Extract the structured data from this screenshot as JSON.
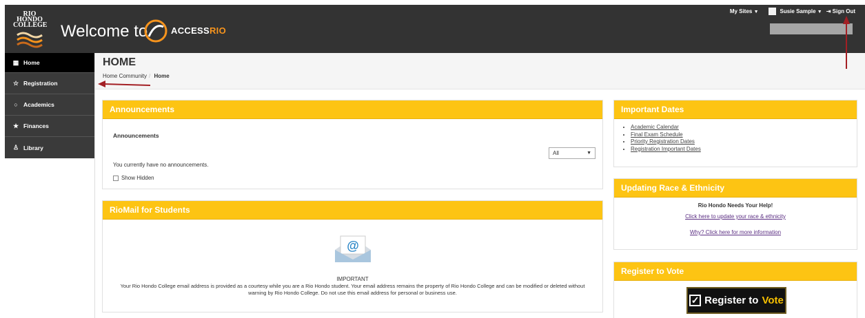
{
  "header": {
    "logo_text": "RIO HONDO COLLEGE",
    "welcome": "Welcome to",
    "brand_prefix": "ACCESS",
    "brand_suffix": "RIO",
    "my_sites": "My Sites",
    "user_name": "Susie Sample",
    "sign_out": "Sign Out",
    "search_icon": "search-bar",
    "accent_color": "#f7941d"
  },
  "sidebar": {
    "items": [
      {
        "label": "Home",
        "icon": "grid-icon",
        "active": true
      },
      {
        "label": "Registration",
        "icon": "star-outline-icon"
      },
      {
        "label": "Academics",
        "icon": "circle-icon"
      },
      {
        "label": "Finances",
        "icon": "star-half-icon"
      },
      {
        "label": "Library",
        "icon": "person-icon"
      }
    ]
  },
  "page": {
    "title": "HOME",
    "breadcrumb": [
      "Home Community",
      "Home"
    ]
  },
  "announcements": {
    "header": "Announcements",
    "subheader": "Announcements",
    "filter_value": "All",
    "empty_text": "You currently have no announcements.",
    "show_hidden_label": "Show Hidden"
  },
  "riomail": {
    "header": "RioMail for Students",
    "important": "IMPORTANT",
    "text": "Your Rio Hondo College email address is provided as a courtesy while you are a Rio Hondo student. Your email address remains the property of Rio Hondo College and can be modified or deleted without warning by Rio Hondo College. Do not use this email address for personal or business use."
  },
  "important_dates": {
    "header": "Important Dates",
    "links": [
      "Academic Calendar",
      "Final Exam Schedule",
      "Priority Registration Dates",
      "Registration Important Dates"
    ]
  },
  "race": {
    "header": "Updating Race & Ethnicity",
    "title": "Rio Hondo Needs Your Help!",
    "link1": "Click here to update your race & ethnicity",
    "link2": "Why? Click here for more information"
  },
  "vote": {
    "header": "Register to Vote",
    "banner_prefix": "Register to",
    "banner_suffix": "Vote"
  },
  "colors": {
    "panel_header": "#fdc413",
    "header_bg": "#333333",
    "sidebar_bg": "#3a3a3a",
    "annotation_arrow": "#a31f24"
  }
}
